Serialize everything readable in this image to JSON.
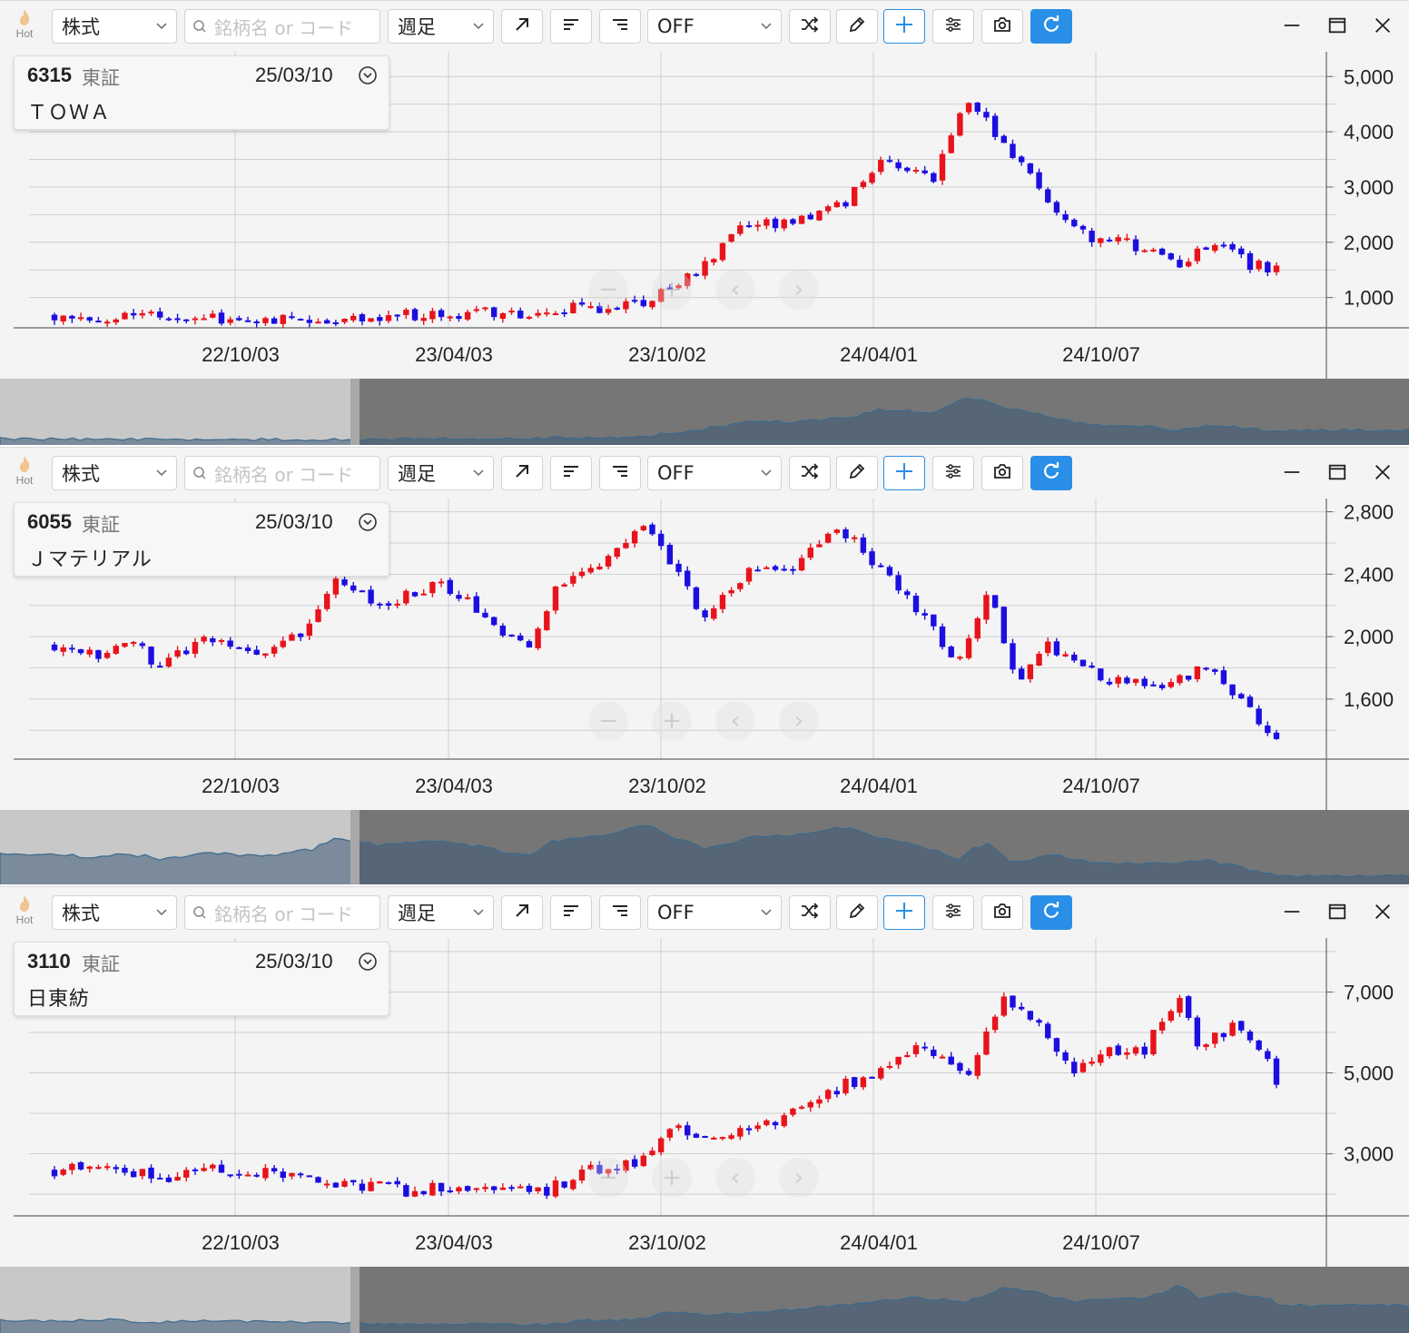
{
  "toolbar": {
    "hot_label": "Hot",
    "type_value": "株式",
    "search_placeholder": "銘柄名 or コード",
    "period_value": "週足",
    "compare_value": "OFF"
  },
  "colors": {
    "up": "#e8131b",
    "down": "#1c0ee0",
    "accent": "#2a8fe6",
    "grid": "#cfcfcf"
  },
  "x_axis_labels": [
    "22/10/03",
    "23/04/03",
    "23/10/02",
    "24/04/01",
    "24/10/07"
  ],
  "panels": [
    {
      "code": "6315",
      "market": "東証",
      "date": "25/03/10",
      "name": "ＴＯＷＡ",
      "chart_data": {
        "type": "candlestick",
        "y_ticks": [
          "5,000",
          "4,000",
          "3,000",
          "2,000",
          "1,000"
        ],
        "y_tick_values": [
          5000,
          4000,
          3000,
          2000,
          1000
        ],
        "ylim": [
          550,
          5350
        ],
        "weeks": 140,
        "first_week": "2022-04-18",
        "last_week": "2025-03-10",
        "closes": [
          {
            "week": 0,
            "close": 700
          },
          {
            "week": 5,
            "close": 640
          },
          {
            "week": 14,
            "close": 630
          },
          {
            "week": 20,
            "close": 600
          },
          {
            "week": 26,
            "close": 640
          },
          {
            "week": 32,
            "close": 600
          },
          {
            "week": 40,
            "close": 700
          },
          {
            "week": 48,
            "close": 700
          },
          {
            "week": 56,
            "close": 760
          },
          {
            "week": 62,
            "close": 830
          },
          {
            "week": 66,
            "close": 870
          },
          {
            "week": 70,
            "close": 1200
          },
          {
            "week": 74,
            "close": 1600
          },
          {
            "week": 78,
            "close": 2300
          },
          {
            "week": 84,
            "close": 2300
          },
          {
            "week": 90,
            "close": 2700
          },
          {
            "week": 94,
            "close": 3500
          },
          {
            "week": 100,
            "close": 3200
          },
          {
            "week": 104,
            "close": 4600
          },
          {
            "week": 108,
            "close": 3700
          },
          {
            "week": 114,
            "close": 2600
          },
          {
            "week": 118,
            "close": 2000
          },
          {
            "week": 122,
            "close": 2000
          },
          {
            "week": 128,
            "close": 1550
          },
          {
            "week": 132,
            "close": 2000
          },
          {
            "week": 136,
            "close": 1600
          },
          {
            "week": 139,
            "close": 1520
          }
        ]
      }
    },
    {
      "code": "6055",
      "market": "東証",
      "date": "25/03/10",
      "name": "Ｊマテリアル",
      "chart_data": {
        "type": "candlestick",
        "y_ticks": [
          "2,800",
          "2,400",
          "2,000",
          "1,600"
        ],
        "y_tick_values": [
          2800,
          2400,
          2000,
          1600
        ],
        "ylim": [
          1250,
          2850
        ],
        "weeks": 140,
        "first_week": "2022-04-18",
        "last_week": "2025-03-10",
        "closes": [
          {
            "week": 0,
            "close": 1950
          },
          {
            "week": 6,
            "close": 1870
          },
          {
            "week": 10,
            "close": 2010
          },
          {
            "week": 14,
            "close": 1800
          },
          {
            "week": 20,
            "close": 2000
          },
          {
            "week": 28,
            "close": 1900
          },
          {
            "week": 34,
            "close": 2050
          },
          {
            "week": 38,
            "close": 2400
          },
          {
            "week": 44,
            "close": 2200
          },
          {
            "week": 52,
            "close": 2340
          },
          {
            "week": 58,
            "close": 2150
          },
          {
            "week": 64,
            "close": 1900
          },
          {
            "week": 68,
            "close": 2350
          },
          {
            "week": 74,
            "close": 2450
          },
          {
            "week": 80,
            "close": 2750
          },
          {
            "week": 84,
            "close": 2400
          },
          {
            "week": 88,
            "close": 2100
          },
          {
            "week": 94,
            "close": 2450
          },
          {
            "week": 100,
            "close": 2450
          },
          {
            "week": 106,
            "close": 2700
          },
          {
            "week": 112,
            "close": 2400
          },
          {
            "week": 118,
            "close": 2100
          },
          {
            "week": 122,
            "close": 1800
          },
          {
            "week": 126,
            "close": 2300
          },
          {
            "week": 130,
            "close": 1700
          },
          {
            "week": 134,
            "close": 1950
          },
          {
            "week": 138,
            "close": 1800
          },
          {
            "week": 144,
            "close": 1700
          },
          {
            "week": 150,
            "close": 1700
          },
          {
            "week": 156,
            "close": 1800
          },
          {
            "week": 160,
            "close": 1600
          },
          {
            "week": 165,
            "close": 1360
          }
        ]
      }
    },
    {
      "code": "3110",
      "market": "東証",
      "date": "25/03/10",
      "name": "日東紡",
      "chart_data": {
        "type": "candlestick",
        "y_ticks": [
          "7,000",
          "5,000",
          "3,000"
        ],
        "y_tick_values": [
          7000,
          5000,
          3000
        ],
        "ylim": [
          1600,
          8200
        ],
        "weeks": 140,
        "first_week": "2022-04-18",
        "last_week": "2025-03-10",
        "closes": [
          {
            "week": 0,
            "close": 2600
          },
          {
            "week": 6,
            "close": 2700
          },
          {
            "week": 12,
            "close": 2400
          },
          {
            "week": 18,
            "close": 2700
          },
          {
            "week": 24,
            "close": 2500
          },
          {
            "week": 32,
            "close": 2300
          },
          {
            "week": 40,
            "close": 2100
          },
          {
            "week": 48,
            "close": 2200
          },
          {
            "week": 56,
            "close": 2050
          },
          {
            "week": 60,
            "close": 2600
          },
          {
            "week": 66,
            "close": 2700
          },
          {
            "week": 70,
            "close": 3700
          },
          {
            "week": 74,
            "close": 3400
          },
          {
            "week": 80,
            "close": 3600
          },
          {
            "week": 86,
            "close": 4300
          },
          {
            "week": 92,
            "close": 4900
          },
          {
            "week": 98,
            "close": 5600
          },
          {
            "week": 104,
            "close": 5100
          },
          {
            "week": 108,
            "close": 6800
          },
          {
            "week": 112,
            "close": 6200
          },
          {
            "week": 116,
            "close": 5000
          },
          {
            "week": 120,
            "close": 5600
          },
          {
            "week": 124,
            "close": 5600
          },
          {
            "week": 128,
            "close": 7000
          },
          {
            "week": 130,
            "close": 5500
          },
          {
            "week": 134,
            "close": 6200
          },
          {
            "week": 138,
            "close": 5500
          },
          {
            "week": 139,
            "close": 4600
          }
        ]
      }
    }
  ]
}
